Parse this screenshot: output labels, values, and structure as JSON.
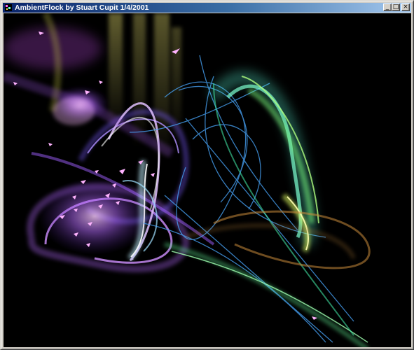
{
  "window": {
    "title": "AmbientFlock by Stuart Cupit 1/4/2001",
    "buttons": {
      "minimize_glyph": "_",
      "maximize_glyph": "□",
      "close_glyph": "×"
    }
  },
  "icons": {
    "app": "app-icon",
    "minimize": "minimize-icon",
    "maximize": "maximize-icon",
    "close": "close-icon"
  },
  "colors": {
    "titlebar_start": "#0a246a",
    "titlebar_end": "#a6caf0",
    "background": "#000000",
    "trail_purple": "#b56bff",
    "trail_violet": "#7a5cff",
    "trail_blue": "#4aa8ff",
    "trail_cyan": "#5fffe0",
    "trail_green": "#7dff7a",
    "trail_yellow": "#e8e070",
    "trail_orange": "#c98a3a",
    "bird_pink": "#ffb3ff"
  }
}
